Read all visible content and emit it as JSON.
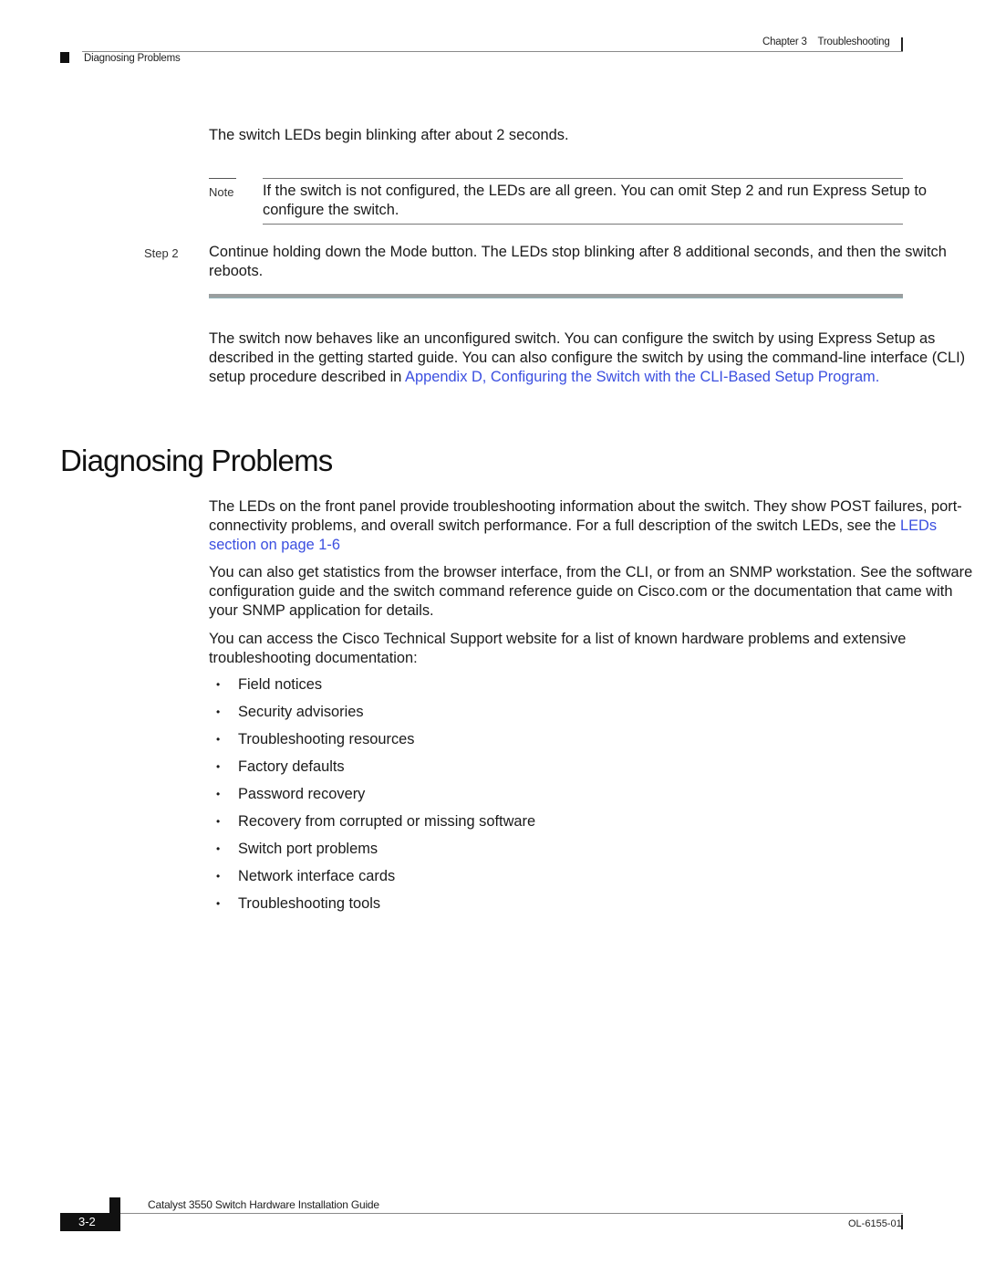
{
  "header": {
    "chapter": "Chapter 3",
    "chapter_title": "Troubleshooting",
    "section": "Diagnosing Problems"
  },
  "intro": "The switch LEDs begin blinking after about 2 seconds.",
  "note": {
    "label": "Note",
    "text": "If the switch is not configured, the LEDs are all green. You can omit Step 2 and run Express Setup to configure the switch."
  },
  "step": {
    "label": "Step 2",
    "text": "Continue holding down the Mode button. The LEDs stop blinking after 8 additional seconds, and then the switch reboots."
  },
  "after_step": {
    "text": "The switch now behaves like an unconfigured switch. You can configure the switch by using Express Setup as described in the getting started guide. You can also configure the switch by using the command-line interface (CLI) setup procedure described in ",
    "link": "Appendix D, Configuring the Switch with the CLI-Based Setup Program."
  },
  "heading": "Diagnosing Problems",
  "paragraphs": {
    "p1_text": "The LEDs on the front panel provide troubleshooting information about the switch. They show POST failures, port-connectivity problems, and overall switch performance. For a full description of the switch LEDs, see the ",
    "p1_link": "LEDs  section on page 1-6",
    "p2": "You can also get statistics from the browser interface, from the CLI, or from an SNMP workstation. See the software configuration guide and the switch command reference guide on Cisco.com or the documentation that came with your SNMP application for details.",
    "p3": "You can access the Cisco Technical Support website for a list of known hardware problems and extensive troubleshooting documentation:"
  },
  "bullets": [
    "Field notices",
    "Security advisories",
    "Troubleshooting resources",
    "Factory defaults",
    "Password recovery",
    "Recovery from corrupted or missing software",
    "Switch port problems",
    "Network interface cards",
    "Troubleshooting tools"
  ],
  "footer": {
    "guide_title": "Catalyst 3550 Switch Hardware Installation Guide",
    "page": "3-2",
    "doc_number": "OL-6155-01"
  },
  "colors": {
    "link": "#3b4fe0",
    "text": "#1a1a1a"
  }
}
